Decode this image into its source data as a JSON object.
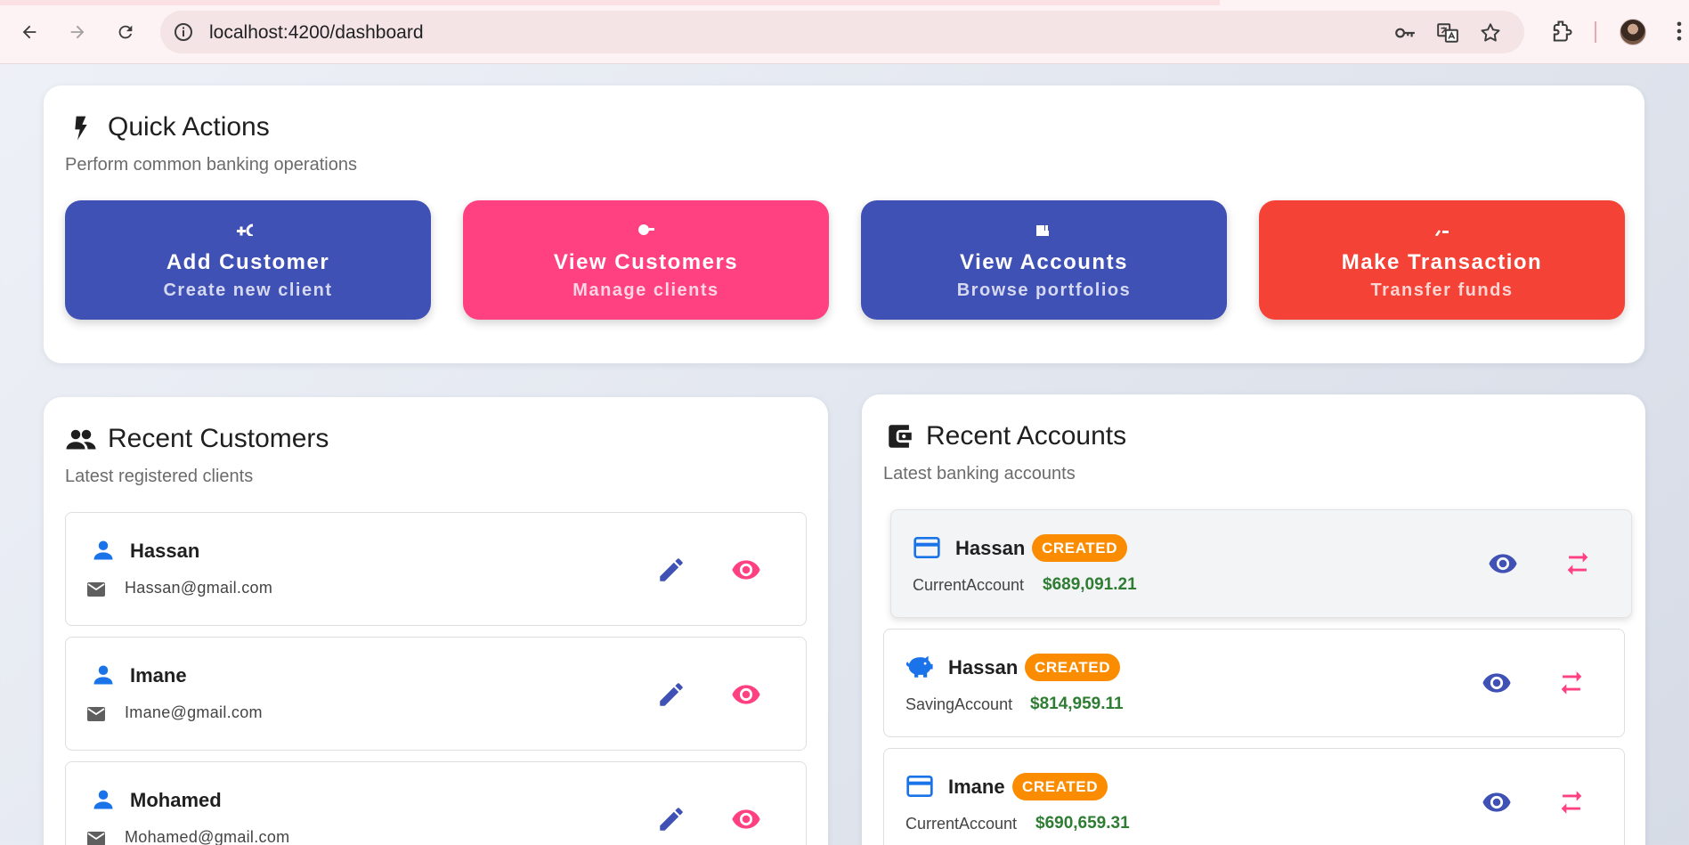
{
  "browser": {
    "url": "localhost:4200/dashboard"
  },
  "quick_actions": {
    "title": "Quick Actions",
    "subtitle": "Perform common banking operations",
    "buttons": [
      {
        "label": "Add Customer",
        "sub": "Create new client",
        "color": "#3f51b5",
        "icon": "person-add-icon"
      },
      {
        "label": "View Customers",
        "sub": "Manage clients",
        "color": "#ff4081",
        "icon": "people-icon"
      },
      {
        "label": "View Accounts",
        "sub": "Browse portfolios",
        "color": "#3f51b5",
        "icon": "account-icon"
      },
      {
        "label": "Make Transaction",
        "sub": "Transfer funds",
        "color": "#f44336",
        "icon": "transfer-icon"
      }
    ]
  },
  "recent_customers": {
    "title": "Recent Customers",
    "subtitle": "Latest registered clients",
    "items": [
      {
        "name": "Hassan",
        "email": "Hassan@gmail.com"
      },
      {
        "name": "Imane",
        "email": "Imane@gmail.com"
      },
      {
        "name": "Mohamed",
        "email": "Mohamed@gmail.com"
      }
    ]
  },
  "recent_accounts": {
    "title": "Recent Accounts",
    "subtitle": "Latest banking accounts",
    "items": [
      {
        "name": "Hassan",
        "status": "CREATED",
        "type": "CurrentAccount",
        "balance": "$689,091.21",
        "icon": "credit-card-icon"
      },
      {
        "name": "Hassan",
        "status": "CREATED",
        "type": "SavingAccount",
        "balance": "$814,959.11",
        "icon": "piggy-bank-icon"
      },
      {
        "name": "Imane",
        "status": "CREATED",
        "type": "CurrentAccount",
        "balance": "$690,659.31",
        "icon": "credit-card-icon"
      }
    ]
  },
  "colors": {
    "primary": "#3f51b5",
    "accent": "#ff4081",
    "warn": "#f44336",
    "badge": "#fb8c00",
    "balance": "#2e7d32",
    "blue_icon": "#1a73e8"
  }
}
